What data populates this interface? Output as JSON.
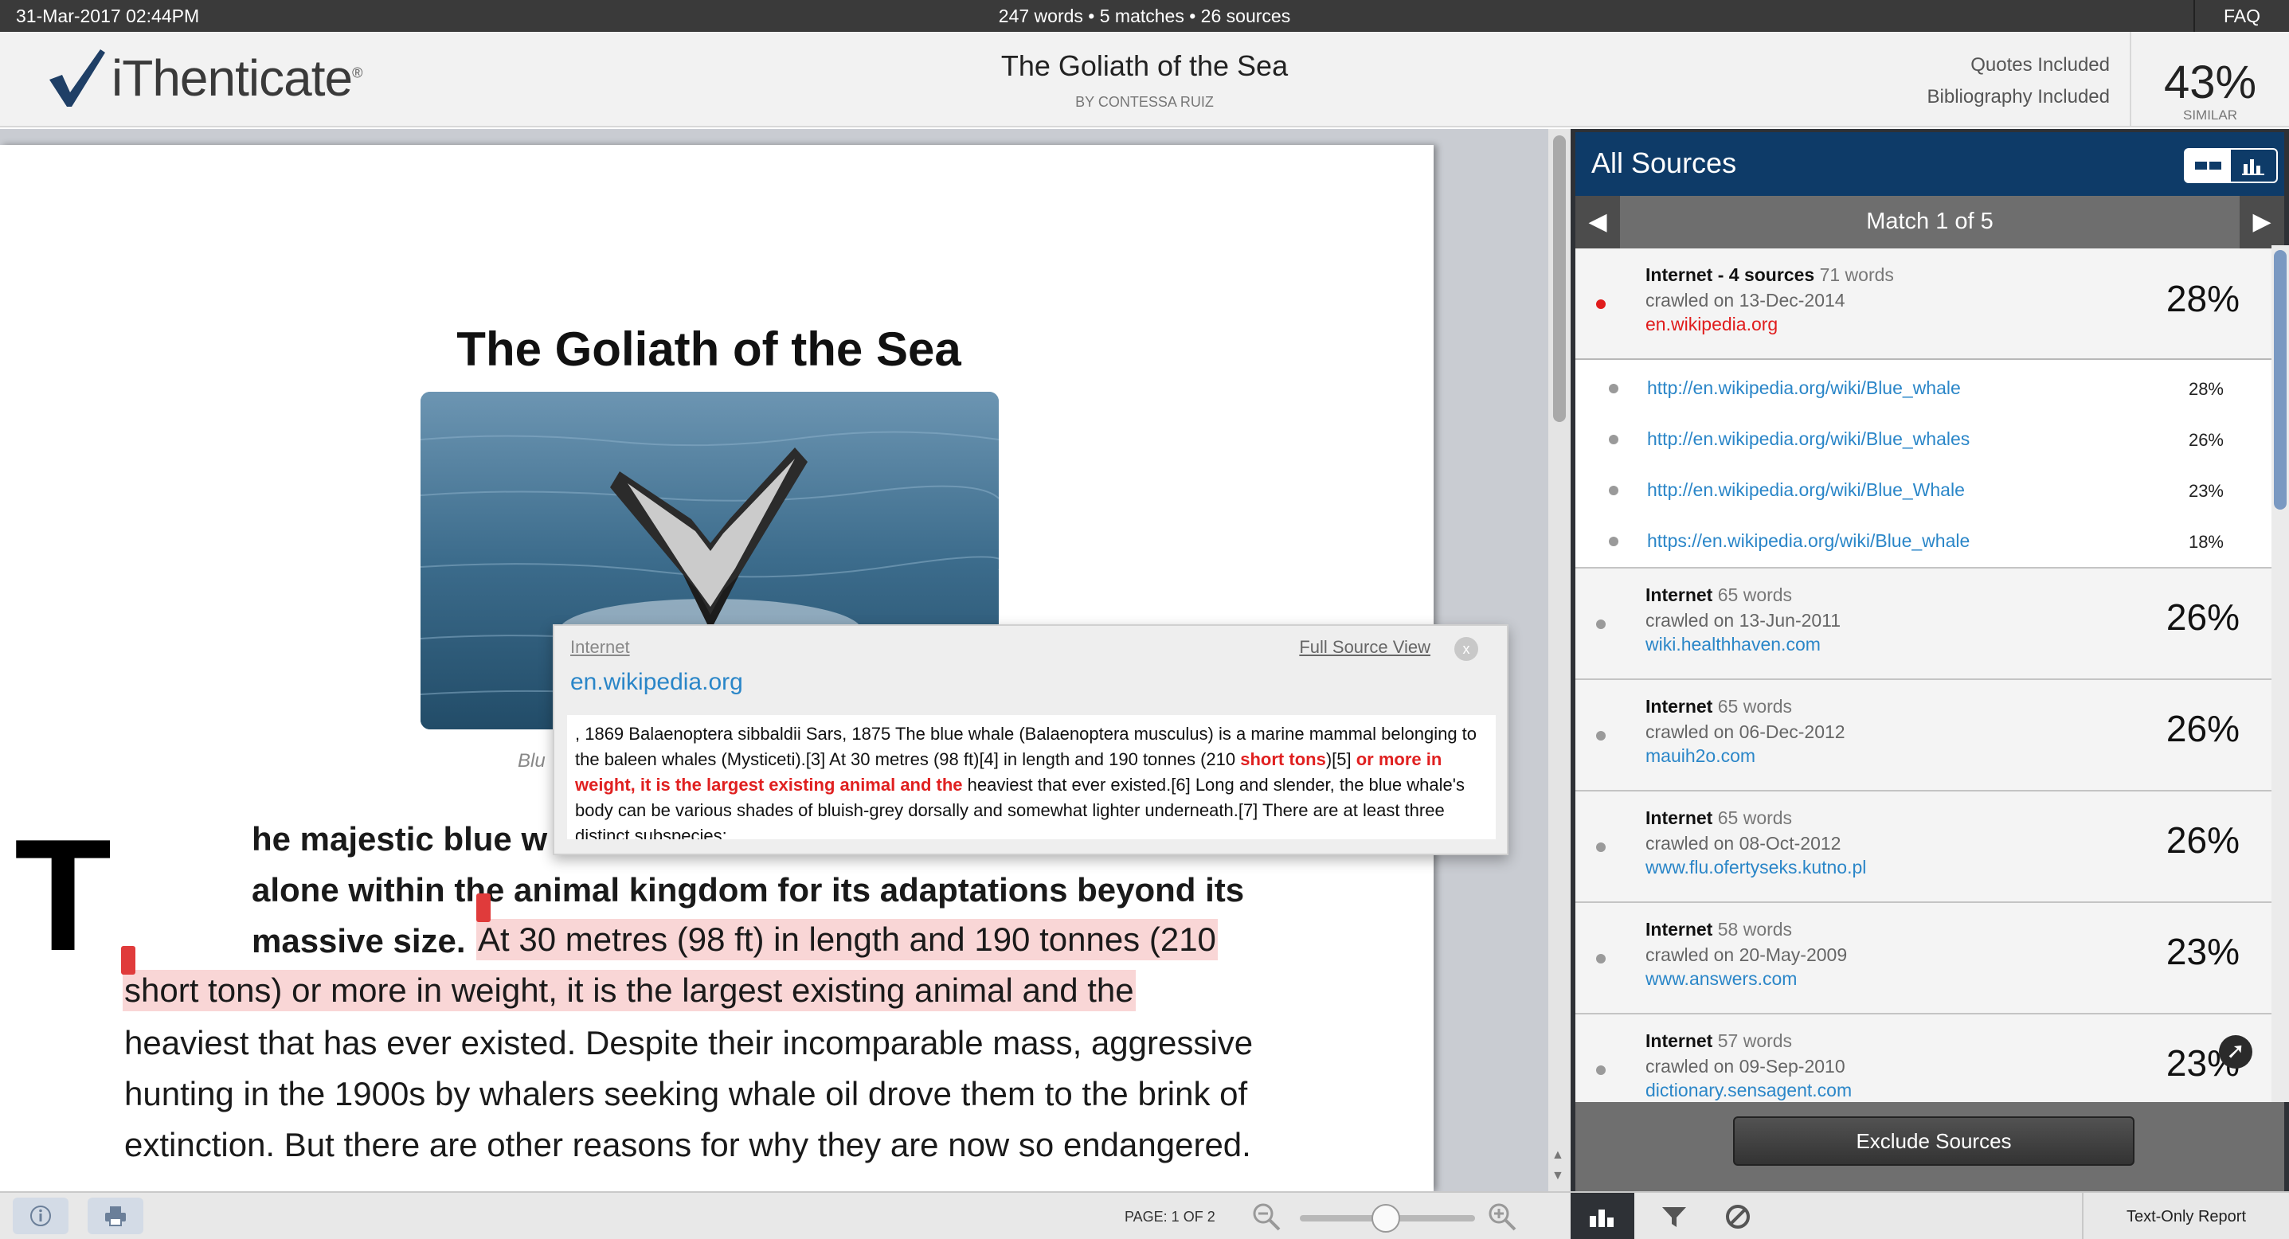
{
  "topbar": {
    "date": "31-Mar-2017 02:44PM",
    "summary": "247 words • 5 matches • 26 sources",
    "faq": "FAQ"
  },
  "header": {
    "logo_text": "iThenticate",
    "logo_mark": "®",
    "title": "The Goliath of the Sea",
    "author": "BY CONTESSA RUIZ",
    "quotes": "Quotes Included",
    "bibliography": "Bibliography Included",
    "similarity": "43%",
    "similarity_label": "SIMILAR"
  },
  "document": {
    "title": "The Goliath of the Sea",
    "caption": "Blu",
    "dropcap": "T",
    "lines": [
      "he majestic blue w",
      "alone within the animal kingdom for its adaptations beyond its",
      "massive size.",
      "At 30 metres (98 ft) in length and 190 tonnes (210",
      "short tons) or more in weight, it is the largest existing animal and the",
      "heaviest that has ever existed. Despite their incomparable mass, aggressive",
      "hunting in the 1900s by whalers seeking whale oil drove them to the brink of",
      "extinction. But there are other reasons for why they are now so endangered."
    ]
  },
  "popup": {
    "type": "Internet",
    "full_source": "Full Source View",
    "close": "x",
    "site": "en.wikipedia.org",
    "text_a": ", 1869 Balaenoptera sibbaldii Sars, 1875 The blue whale (Balaenoptera musculus) is a marine mammal belonging to the baleen whales (Mysticeti).[3] At 30 metres (98 ft)[4] in length and 190 tonnes (210 ",
    "text_red1": "short tons",
    "text_b": ")[5] ",
    "text_red2": "or more in weight, it is the largest existing animal and the",
    "text_c": " heaviest that ever existed.[6] Long and slender, the blue whale's body can be various shades of bluish-grey dorsally and somewhat lighter underneath.[7] There are at least three distinct subspecies:"
  },
  "panel": {
    "title": "All Sources",
    "match_label": "Match 1 of 5",
    "exclude": "Exclude Sources",
    "text_only": "Text-Only Report",
    "page_indicator": "PAGE: 1 OF 2",
    "sources": [
      {
        "name": "Internet - 4 sources",
        "words": "71 words",
        "crawled": "crawled on 13-Dec-2014",
        "site": "en.wikipedia.org",
        "pct": "28%"
      },
      {
        "name": "Internet",
        "words": "65 words",
        "crawled": "crawled on 13-Jun-2011",
        "site": "wiki.healthhaven.com",
        "pct": "26%"
      },
      {
        "name": "Internet",
        "words": "65 words",
        "crawled": "crawled on 06-Dec-2012",
        "site": "mauih2o.com",
        "pct": "26%"
      },
      {
        "name": "Internet",
        "words": "65 words",
        "crawled": "crawled on 08-Oct-2012",
        "site": "www.flu.ofertyseks.kutno.pl",
        "pct": "26%"
      },
      {
        "name": "Internet",
        "words": "58 words",
        "crawled": "crawled on 20-May-2009",
        "site": "www.answers.com",
        "pct": "23%"
      },
      {
        "name": "Internet",
        "words": "57 words",
        "crawled": "crawled on 09-Sep-2010",
        "site": "dictionary.sensagent.com",
        "pct": "23%"
      }
    ],
    "subsources": [
      {
        "url": "http://en.wikipedia.org/wiki/Blue_whale",
        "pct": "28%"
      },
      {
        "url": "http://en.wikipedia.org/wiki/Blue_whales",
        "pct": "26%"
      },
      {
        "url": "http://en.wikipedia.org/wiki/Blue_Whale",
        "pct": "23%"
      },
      {
        "url": "https://en.wikipedia.org/wiki/Blue_whale",
        "pct": "18%"
      }
    ]
  },
  "colors": {
    "accent": "#0e3b68",
    "link": "#2a86c8",
    "match": "#e01c1c",
    "highlight": "#f9d6d6"
  }
}
